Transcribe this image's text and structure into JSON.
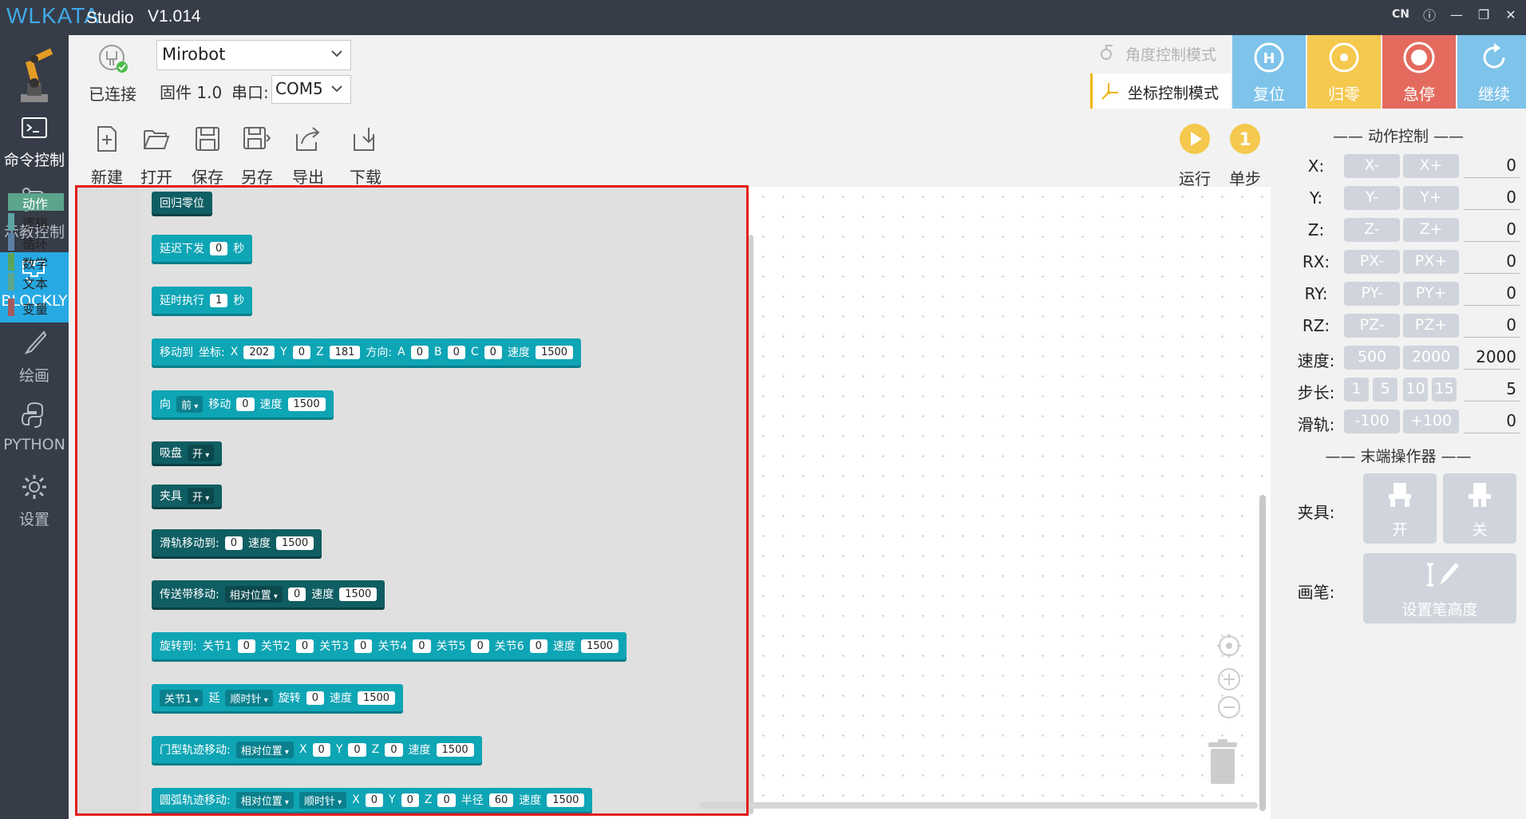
{
  "app": {
    "logo_text": "WLKATA",
    "studio_text": "Studio",
    "version": "V1.014"
  },
  "window": {
    "lang": "CN",
    "info_icon": "info-icon",
    "minimize_icon": "minimize-icon",
    "maximize_icon": "maximize-icon",
    "close_icon": "close-icon"
  },
  "sidebar": {
    "items": [
      {
        "label": "命令控制",
        "icon": "terminal-icon"
      },
      {
        "label": "示教控制",
        "icon": "teach-icon"
      },
      {
        "label": "BLOCKLY",
        "icon": "blockly-icon"
      },
      {
        "label": "绘画",
        "icon": "brush-icon"
      },
      {
        "label": "PYTHON",
        "icon": "python-icon"
      },
      {
        "label": "设置",
        "icon": "gear-icon"
      }
    ]
  },
  "connection": {
    "status": "已连接",
    "model": "Mirobot",
    "firmware": "固件 1.0",
    "port_label": "串口:",
    "port": "COM5"
  },
  "file_toolbar": {
    "new": "新建",
    "open": "打开",
    "save": "保存",
    "save_as": "另存",
    "export": "导出",
    "download": "下载"
  },
  "modes": {
    "angle": "角度控制模式",
    "coord": "坐标控制模式"
  },
  "big_buttons": {
    "reset": "复位",
    "home": "归零",
    "estop": "急停",
    "resume": "继续"
  },
  "run": {
    "run": "运行",
    "step": "单步"
  },
  "toolbox": {
    "categories": [
      "动作",
      "逻辑",
      "循环",
      "数学",
      "文本",
      "变量"
    ],
    "colors": [
      "#5ba58c",
      "#5ba5a5",
      "#5b80a5",
      "#5ba55b",
      "#5ba58c",
      "#a55b5b"
    ]
  },
  "blocks": {
    "home": "回归零位",
    "delay_send": {
      "label": "延迟下发",
      "value": "0",
      "unit": "秒"
    },
    "delay_exec": {
      "label": "延时执行",
      "value": "1",
      "unit": "秒"
    },
    "move_to": {
      "label": "移动到",
      "coord": "坐标:",
      "x_label": "X",
      "x": "202",
      "y_label": "Y",
      "y": "0",
      "z_label": "Z",
      "z": "181",
      "dir": "方向:",
      "a_label": "A",
      "a": "0",
      "b_label": "B",
      "b": "0",
      "c_label": "C",
      "c": "0",
      "speed_label": "速度",
      "speed": "1500"
    },
    "move_dir": {
      "to": "向",
      "dir": "前",
      "move": "移动",
      "value": "0",
      "speed_label": "速度",
      "speed": "1500"
    },
    "suction": {
      "label": "吸盘",
      "value": "开"
    },
    "gripper": {
      "label": "夹具",
      "value": "开"
    },
    "rail": {
      "label": "滑轨移动到:",
      "value": "0",
      "speed_label": "速度",
      "speed": "1500"
    },
    "conveyor": {
      "label": "传送带移动:",
      "mode": "相对位置",
      "value": "0",
      "speed_label": "速度",
      "speed": "1500"
    },
    "rotate": {
      "label": "旋转到:",
      "j1": "关节1",
      "v1": "0",
      "j2": "关节2",
      "v2": "0",
      "j3": "关节3",
      "v3": "0",
      "j4": "关节4",
      "v4": "0",
      "j5": "关节5",
      "v5": "0",
      "j6": "关节6",
      "v6": "0",
      "speed_label": "速度",
      "speed": "1500"
    },
    "joint_rot": {
      "joint": "关节1",
      "along": "延",
      "dir": "顺时针",
      "rot": "旋转",
      "value": "0",
      "speed_label": "速度",
      "speed": "1500"
    },
    "gate": {
      "label": "门型轨迹移动:",
      "mode": "相对位置",
      "x_label": "X",
      "x": "0",
      "y_label": "Y",
      "y": "0",
      "z_label": "Z",
      "z": "0",
      "speed_label": "速度",
      "speed": "1500"
    },
    "arc": {
      "label": "圆弧轨迹移动:",
      "mode": "相对位置",
      "dir": "顺时针",
      "x_label": "X",
      "x": "0",
      "y_label": "Y",
      "y": "0",
      "z_label": "Z",
      "z": "0",
      "r_label": "半径",
      "r": "60",
      "speed_label": "速度",
      "speed": "1500"
    }
  },
  "motion_panel": {
    "title": "—— 动作控制 ——",
    "rows": [
      {
        "label": "X:",
        "minus": "X-",
        "plus": "X+",
        "value": "0"
      },
      {
        "label": "Y:",
        "minus": "Y-",
        "plus": "Y+",
        "value": "0"
      },
      {
        "label": "Z:",
        "minus": "Z-",
        "plus": "Z+",
        "value": "0"
      },
      {
        "label": "RX:",
        "minus": "PX-",
        "plus": "PX+",
        "value": "0"
      },
      {
        "label": "RY:",
        "minus": "PY-",
        "plus": "PY+",
        "value": "0"
      },
      {
        "label": "RZ:",
        "minus": "PZ-",
        "plus": "PZ+",
        "value": "0"
      }
    ],
    "speed": {
      "label": "速度:",
      "opt1": "500",
      "opt2": "2000",
      "value": "2000"
    },
    "step": {
      "label": "步长:",
      "options": [
        "1",
        "5",
        "10",
        "15"
      ],
      "value": "5"
    },
    "rail": {
      "label": "滑轨:",
      "minus": "-100",
      "plus": "+100",
      "value": "0"
    }
  },
  "effector_panel": {
    "title": "—— 末端操作器 ——",
    "gripper_label": "夹具:",
    "open": "开",
    "close": "关",
    "pen_label": "画笔:",
    "pen_btn": "设置笔高度"
  }
}
